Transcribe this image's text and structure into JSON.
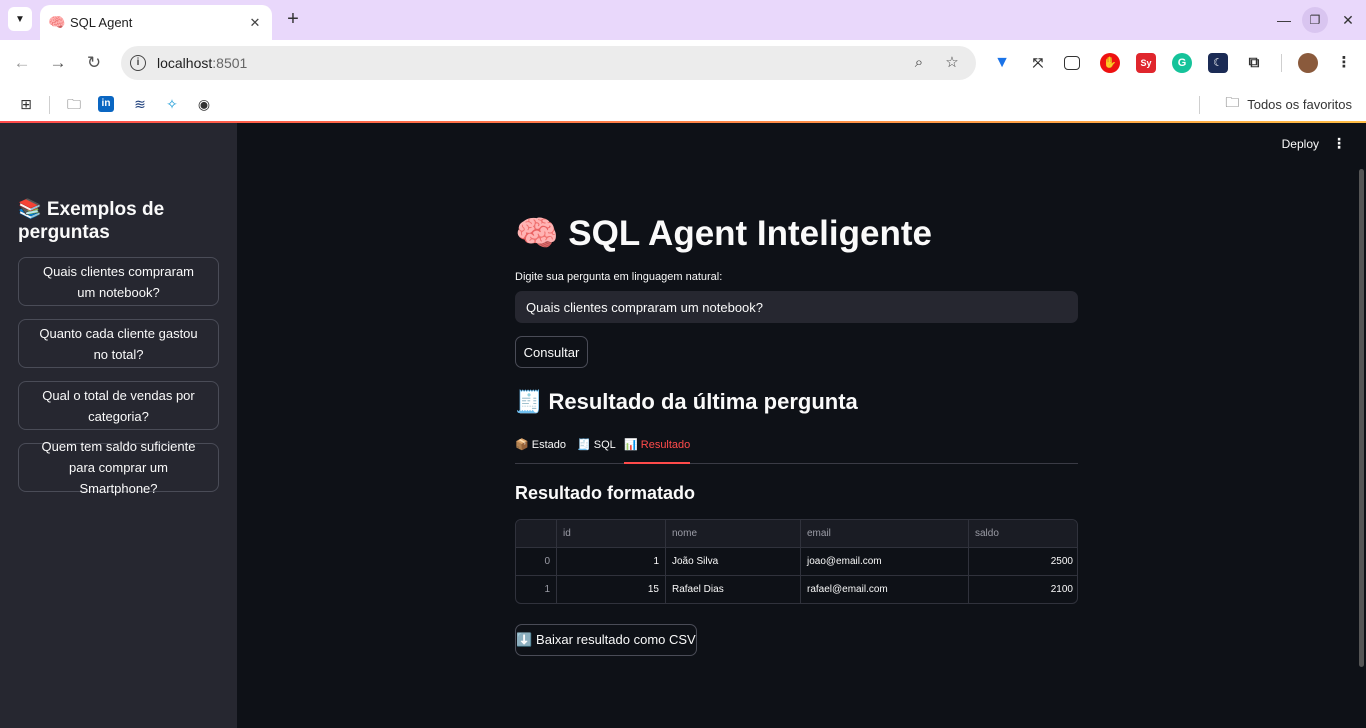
{
  "browser": {
    "tab_title": "SQL Agent",
    "tab_favicon": "🧠",
    "url_host": "localhost",
    "url_port": ":8501",
    "bookmarks_all_label": "Todos os favoritos"
  },
  "app": {
    "deploy_label": "Deploy",
    "title": "🧠 SQL Agent Inteligente",
    "question_label": "Digite sua pergunta em linguagem natural:",
    "question_value": "Quais clientes compraram um notebook?",
    "consult_label": "Consultar",
    "result_title": "🧾 Resultado da última pergunta",
    "tabs": [
      {
        "label": "📦 Estado"
      },
      {
        "label": "🧾 SQL"
      },
      {
        "label": "📊 Resultado"
      }
    ],
    "formatted_title": "Resultado formatado",
    "download_label": "⬇️ Baixar resultado como CSV"
  },
  "sidebar": {
    "title": "📚 Exemplos de perguntas",
    "examples": [
      {
        "label": "Quais clientes compraram um notebook?"
      },
      {
        "label": "Quanto cada cliente gastou no total?"
      },
      {
        "label": "Qual o total de vendas por categoria?"
      },
      {
        "label": "Quem tem saldo suficiente para comprar um Smartphone?"
      }
    ]
  },
  "table": {
    "columns": [
      "",
      "id",
      "nome",
      "email",
      "saldo"
    ],
    "rows": [
      [
        "0",
        "1",
        "João Silva",
        "joao@email.com",
        "2500"
      ],
      [
        "1",
        "15",
        "Rafael Dias",
        "rafael@email.com",
        "2100"
      ]
    ]
  },
  "colors": {
    "accent": "#ff4b4b",
    "sidebar_bg": "#262730",
    "main_bg": "#0e1117",
    "browser_tabbar": "#e9d8fb"
  }
}
